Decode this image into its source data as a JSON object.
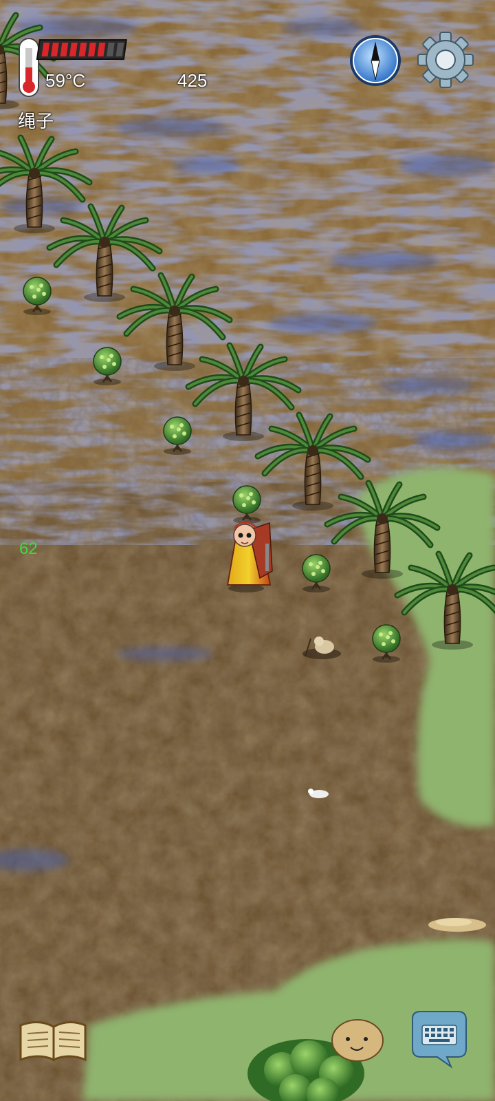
{
  "hud": {
    "temperature": "59°C",
    "health_bars_filled": 7,
    "health_bars_total": 9,
    "score": "425",
    "held_item": "绳子",
    "indicator": "62"
  },
  "icons": {
    "thermometer": "thermometer-icon",
    "compass": "compass-icon",
    "settings": "gear-icon",
    "journal": "book-icon",
    "emote": "face-icon",
    "chat": "keyboard-icon"
  },
  "colors": {
    "health_fill": "#d8262a",
    "health_empty": "#555555",
    "indicator": "#3ddc3d",
    "grass": "#8fb46e",
    "dirt": "#6b5230",
    "swamp_water": "#4a5a9a"
  }
}
